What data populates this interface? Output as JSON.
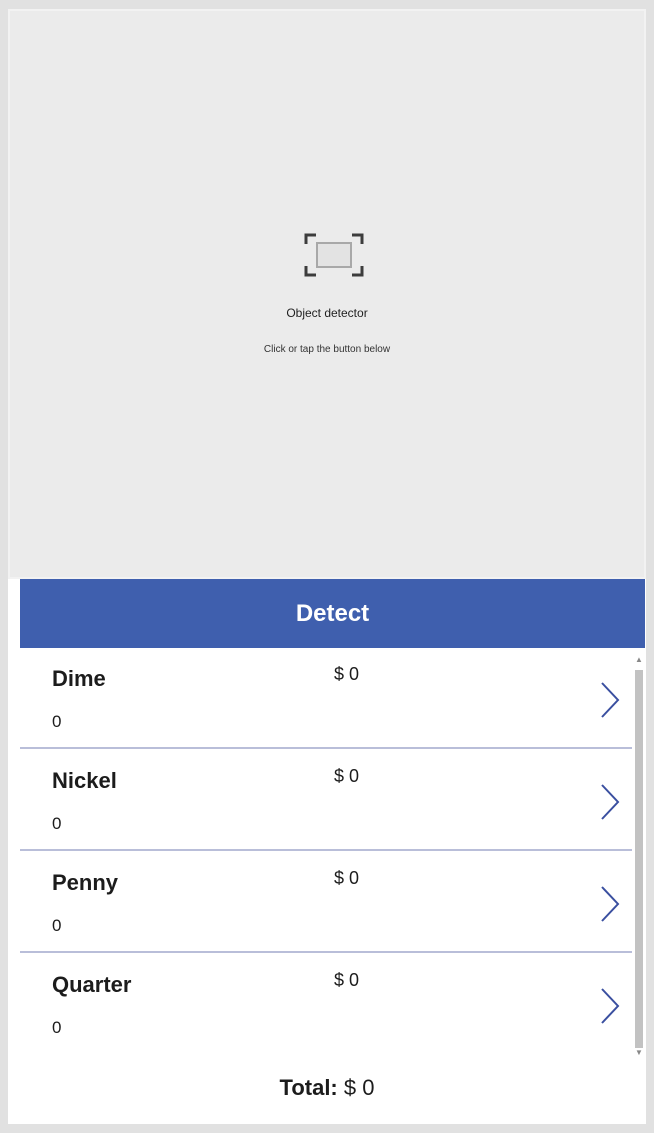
{
  "detector": {
    "icon": "camera-frame-icon",
    "title": "Object detector",
    "hint": "Click or tap the button below"
  },
  "detect_button": {
    "label": "Detect"
  },
  "coins": [
    {
      "name": "Dime",
      "count": "0",
      "value": "$ 0"
    },
    {
      "name": "Nickel",
      "count": "0",
      "value": "$ 0"
    },
    {
      "name": "Penny",
      "count": "0",
      "value": "$ 0"
    },
    {
      "name": "Quarter",
      "count": "0",
      "value": "$ 0"
    }
  ],
  "total": {
    "label": "Total:",
    "value": "$ 0"
  },
  "colors": {
    "accent": "#3f5fae",
    "chevron": "#3a4fa0",
    "divider": "#b9bed9",
    "detector_bg": "#ebebeb"
  }
}
